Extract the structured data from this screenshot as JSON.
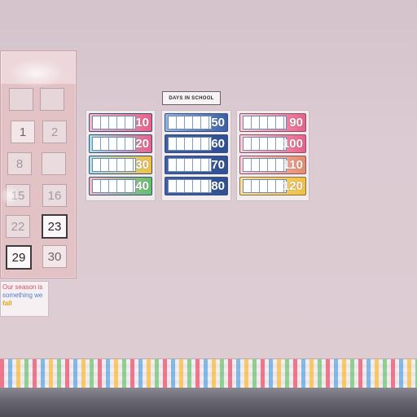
{
  "calendar": {
    "days": [
      "1",
      "2",
      "8",
      "15",
      "16",
      "22",
      "23",
      "29",
      "30"
    ]
  },
  "note": {
    "line1": "Our season is",
    "line2": "something we",
    "line3": "fall"
  },
  "chart": {
    "title": "DAYS IN SCHOOL",
    "columns": [
      {
        "numbers": [
          "10",
          "20",
          "30",
          "40"
        ]
      },
      {
        "numbers": [
          "50",
          "60",
          "70",
          "80"
        ]
      },
      {
        "numbers": [
          "90",
          "100",
          "110",
          "120"
        ]
      }
    ],
    "colors": {
      "pink": "#e8608a",
      "teal": "#4cc0c8",
      "yellow": "#f0c040",
      "blue": "#3a5fa8",
      "green": "#5fbf6a"
    }
  }
}
